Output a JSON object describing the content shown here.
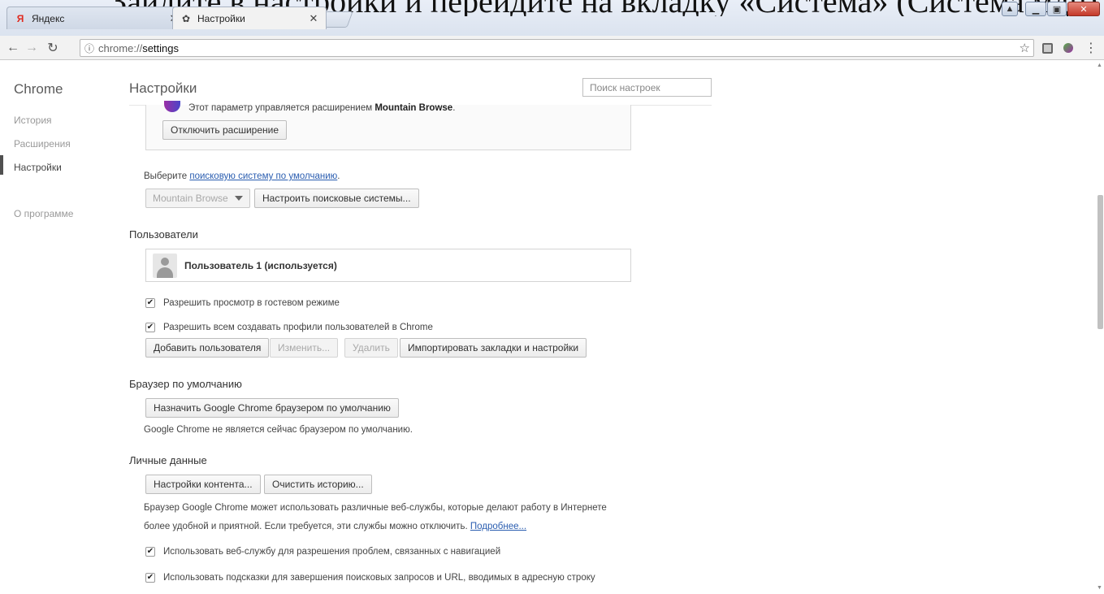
{
  "banner": {
    "text": "Зайдите в настройки и перейдите на вкладку «Система» (Система мдн)"
  },
  "tabs": [
    {
      "label": "Яндекс",
      "icon": "yandex-icon",
      "active": false
    },
    {
      "label": "Настройки",
      "icon": "gear-icon",
      "active": true
    }
  ],
  "address": {
    "scheme": "chrome://",
    "path": "settings"
  },
  "nav": {
    "brand": "Chrome",
    "items": [
      {
        "label": "История"
      },
      {
        "label": "Расширения"
      },
      {
        "label": "Настройки",
        "selected": true
      },
      {
        "label": "О программе"
      }
    ]
  },
  "header": {
    "title": "Настройки",
    "search_placeholder": "Поиск настроек"
  },
  "extension_notice": {
    "message_prefix": "Этот параметр управляется расширением ",
    "extension_name": "Mountain Browse",
    "message_suffix": ".",
    "disable_button": "Отключить расширение"
  },
  "search_engine": {
    "prefix": "Выберите ",
    "link": "поисковую систему по умолчанию",
    "suffix": ".",
    "selected": "Mountain Browse",
    "manage_button": "Настроить поисковые системы..."
  },
  "users": {
    "title": "Пользователи",
    "current_user": "Пользователь 1 (используется)",
    "checkboxes": [
      {
        "label": "Разрешить просмотр в гостевом режиме",
        "checked": true
      },
      {
        "label": "Разрешить всем создавать профили пользователей в Chrome",
        "checked": true
      }
    ],
    "buttons": {
      "add": "Добавить пользователя",
      "edit": "Изменить...",
      "delete": "Удалить",
      "import": "Импортировать закладки и настройки"
    }
  },
  "default_browser": {
    "title": "Браузер по умолчанию",
    "button": "Назначить Google Chrome браузером по умолчанию",
    "status": "Google Chrome не является сейчас браузером по умолчанию."
  },
  "privacy": {
    "title": "Личные данные",
    "content_button": "Настройки контента...",
    "clear_button": "Очистить историю...",
    "desc_line1": "Браузер Google Chrome может использовать различные веб-службы, которые делают работу в Интернете",
    "desc_line2": "более удобной и приятной. Если требуется, эти службы можно отключить. ",
    "more_link": "Подробнее...",
    "checkboxes": [
      {
        "label": "Использовать веб-службу для разрешения проблем, связанных с навигацией",
        "checked": true
      },
      {
        "label": "Использовать подсказки для завершения поисковых запросов и URL, вводимых в адресную строку",
        "checked": true
      }
    ]
  },
  "colors": {
    "accent_link": "#2a5db0",
    "close_button": "#c4392a"
  }
}
